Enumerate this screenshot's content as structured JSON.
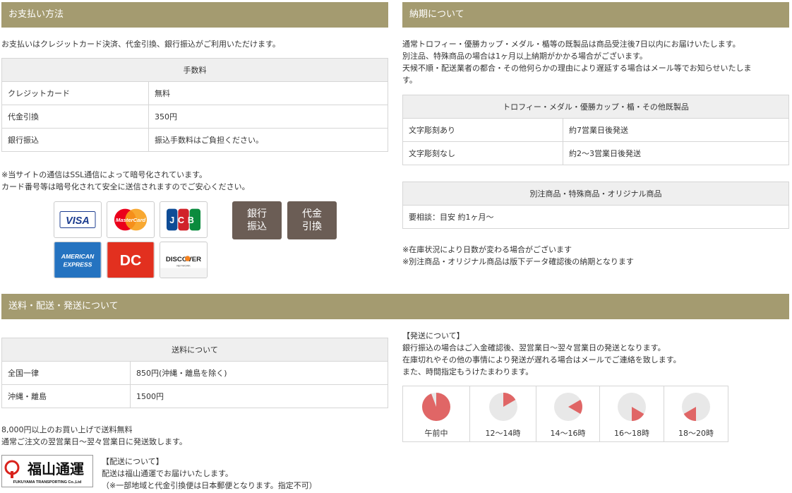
{
  "payment": {
    "header": "お支払い方法",
    "intro": "お支払いはクレジットカード決済、代金引換、銀行振込がご利用いただけます。",
    "table_header": "手数料",
    "rows": [
      {
        "method": "クレジットカード",
        "fee": "無料"
      },
      {
        "method": "代金引換",
        "fee": "350円"
      },
      {
        "method": "銀行振込",
        "fee": "振込手数料はご負担ください。"
      }
    ],
    "ssl_note_1": "※当サイトの通信はSSL通信によって暗号化されています。",
    "ssl_note_2": "カード番号等は暗号化されて安全に送信されますのでご安心ください。",
    "cards": {
      "visa": "VISA",
      "mastercard": "MasterCard",
      "jcb": "JCB",
      "amex_1": "AMERICAN",
      "amex_2": "EXPRESS",
      "diners": "DC",
      "discover": "DISCOVER",
      "discover_sub": "NETWORK"
    },
    "bank_button": [
      "銀行",
      "振込"
    ],
    "cod_button": [
      "代金",
      "引換"
    ]
  },
  "delivery": {
    "header": "納期について",
    "line_1": "通常トロフィー・優勝カップ・メダル・楯等の既製品は商品受注後7日以内にお届けいたします。",
    "line_2": "別注品、特殊商品の場合は1ヶ月以上納期がかかる場合がございます。",
    "line_3": "天候不順・配送業者の都合・その他何らかの理由により遅延する場合はメール等でお知らせいたしま",
    "line_4": "す。",
    "table1_header": "トロフィー・メダル・優勝カップ・楯・その他既製品",
    "table1_rows": [
      {
        "label": "文字彫刻あり",
        "value": "約7営業日後発送"
      },
      {
        "label": "文字彫刻なし",
        "value": "約2〜3営業日後発送"
      }
    ],
    "table2_header": "別注商品・特殊商品・オリジナル商品",
    "table2_row": "要相談：目安 約1ヶ月〜",
    "note_1": "※在庫状況により日数が変わる場合がございます",
    "note_2": "※別注商品・オリジナル商品は版下データ確認後の納期となります"
  },
  "shipping": {
    "header": "送料・配送・発送について",
    "table_header": "送料について",
    "rows": [
      {
        "region": "全国一律",
        "fee": "850円(沖縄・離島を除く)"
      },
      {
        "region": "沖縄・離島",
        "fee": "1500円"
      }
    ],
    "free_note": "8,000円以上のお買い上げで送料無料",
    "ship_note": "通常ご注文の翌営業日〜翌々営業日に発送致します。",
    "carrier_title": "【配送について】",
    "carrier_line_1": "配送は福山通運でお届けいたします。",
    "carrier_line_2": "（※一部地域と代金引換便は日本郵便となります。指定不可）",
    "logo_main": "福山通運",
    "logo_sub": "FUKUYAMA TRANSPORTING Co.,Ltd",
    "dispatch_title": "【発送について】",
    "dispatch_line_1": "銀行振込の場合はご入金確認後、翌営業日〜翌々営業日の発送となります。",
    "dispatch_line_2": "在庫切れやその他の事情により発送が遅れる場合はメールでご連絡を致します。",
    "dispatch_line_3": "また、時間指定もうけたまわります。",
    "time_slots": [
      "午前中",
      "12〜14時",
      "14〜16時",
      "16〜18時",
      "18〜20時"
    ],
    "accent_color": "#e06666"
  }
}
